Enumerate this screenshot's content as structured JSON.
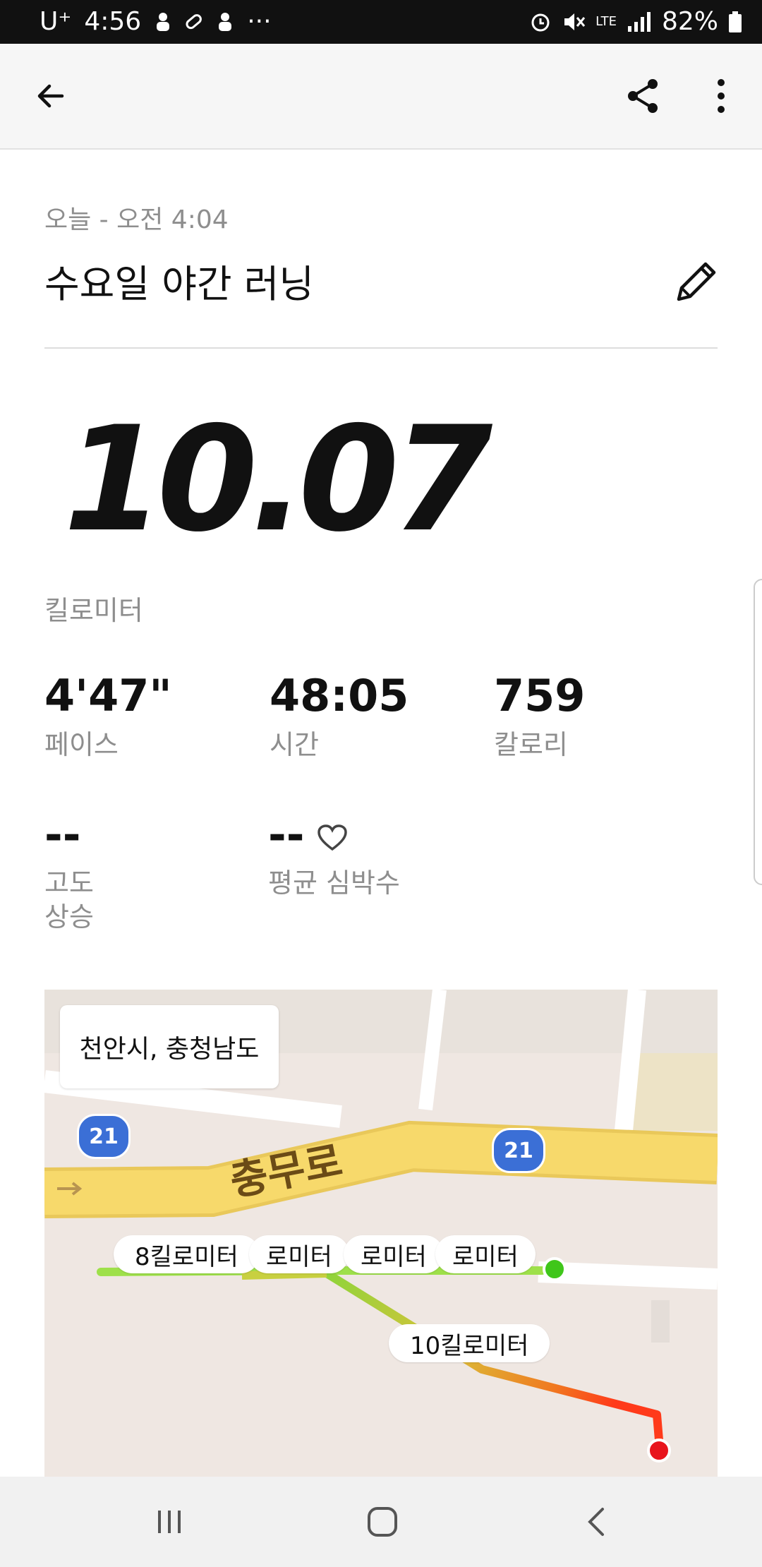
{
  "status_bar": {
    "carrier": "U⁺",
    "time": "4:56",
    "more": "···",
    "network": "LTE",
    "battery": "82%"
  },
  "header": {
    "back_icon": "arrow-left-icon",
    "share_icon": "share-icon",
    "more_icon": "more-vertical-icon"
  },
  "activity": {
    "date": "오늘 - 오전 4:04",
    "title": "수요일 야간 러닝",
    "edit_icon": "pencil-icon",
    "distance": "10.07",
    "distance_unit": "킬로미터"
  },
  "stats": [
    {
      "value": "4'47\"",
      "label": "페이스"
    },
    {
      "value": "48:05",
      "label": "시간"
    },
    {
      "value": "759",
      "label": "칼로리"
    }
  ],
  "stats2": [
    {
      "value": "--",
      "label": "고도\n상승"
    },
    {
      "value": "--",
      "label": "평균 심박수",
      "icon": "heart-icon"
    }
  ],
  "map": {
    "location": "천안시, 충청남도",
    "road_name": "충무로",
    "route_shield": "21",
    "km_labels": [
      "8킬로미터",
      "로미터",
      "로미터",
      "로미터",
      "10킬로미터"
    ],
    "route_colors": {
      "start": "#8fd43a",
      "mid": "#f0c040",
      "end": "#ff3a1a"
    },
    "start_color": "#3fc61a",
    "end_color": "#e8141c"
  },
  "nav": {
    "recents_icon": "recents-icon",
    "home_icon": "home-icon",
    "back_icon": "back-chevron-icon"
  }
}
